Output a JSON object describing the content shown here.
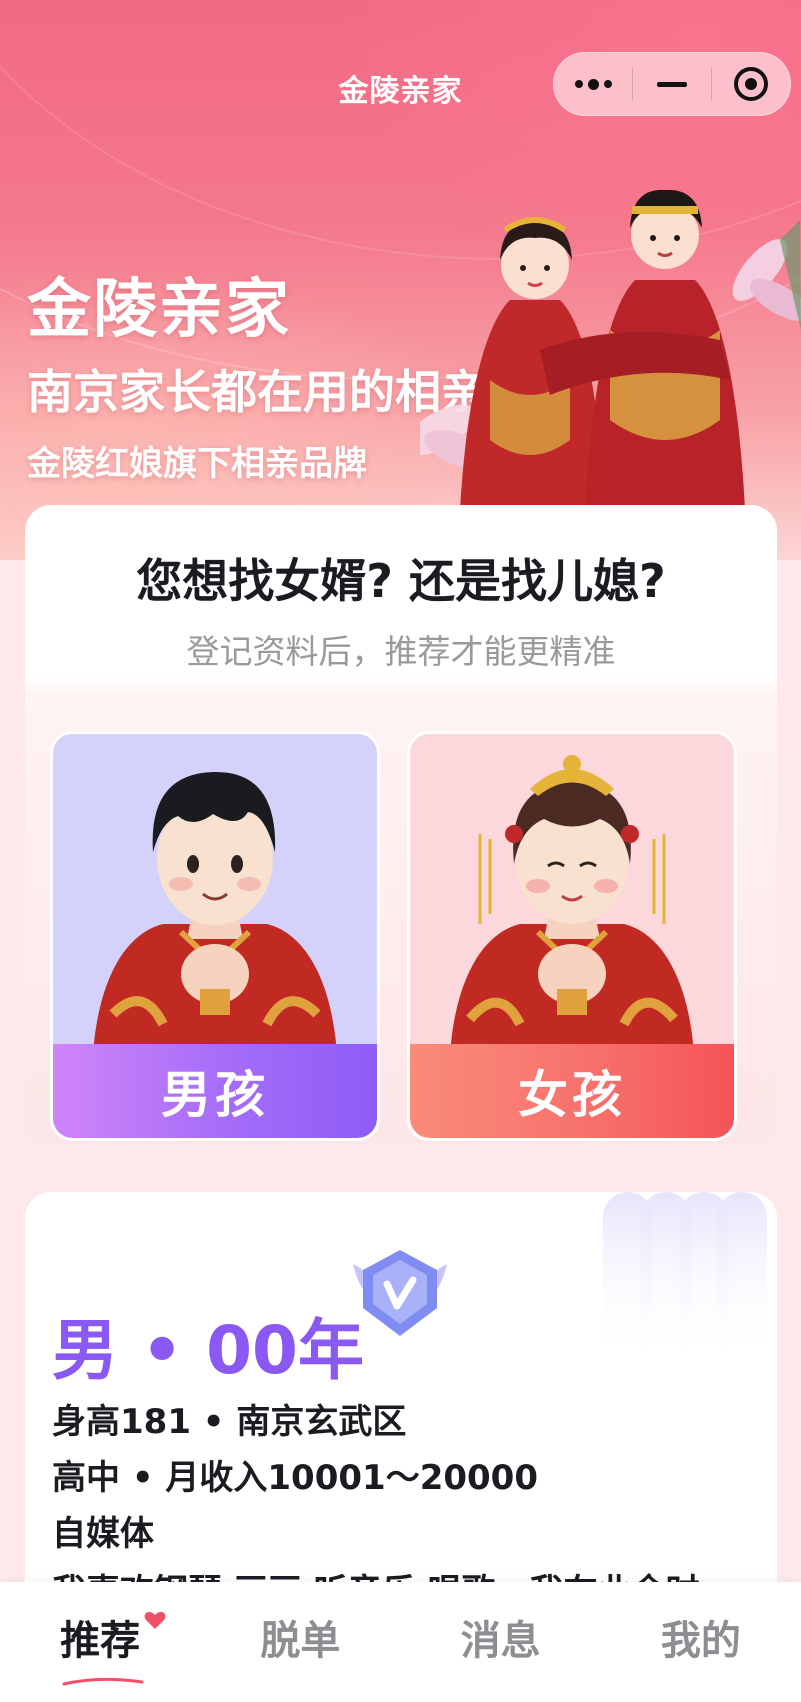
{
  "window": {
    "title": "金陵亲家"
  },
  "hero": {
    "brand": "金陵亲家",
    "slogan": "南京家长都在用的相亲平台",
    "sub_slogan": "金陵红娘旗下相亲品牌"
  },
  "choice": {
    "question": "您想找女婿? 还是找儿媳?",
    "hint": "登记资料后，推荐才能更精准",
    "options": [
      {
        "label": "男孩"
      },
      {
        "label": "女孩"
      }
    ]
  },
  "profile": {
    "title": "男 • 00年",
    "lines": [
      "身高181 • 南京玄武区",
      "高中 • 月收入10001～20000",
      "自媒体",
      "我喜欢钢琴 画画 听音乐 唱歌，我在业余时"
    ]
  },
  "tabs": [
    {
      "label": "推荐",
      "active": true
    },
    {
      "label": "脱单"
    },
    {
      "label": "消息"
    },
    {
      "label": "我的"
    }
  ],
  "colors": {
    "boy_accent": "#8a58f2",
    "girl_accent": "#f45458",
    "tab_active": "#1d1b22",
    "tab_inactive": "#8d8d92",
    "heart": "#f0506a"
  }
}
